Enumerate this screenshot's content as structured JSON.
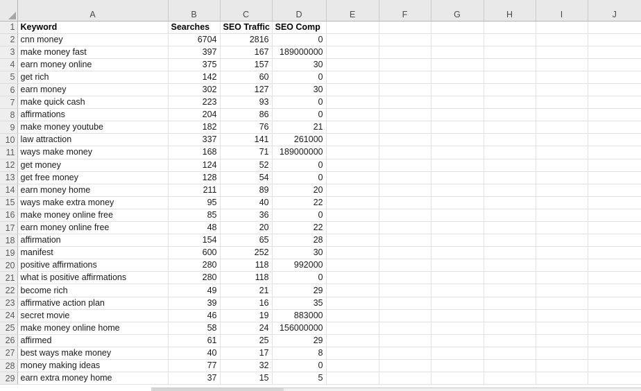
{
  "app": {
    "type": "spreadsheet",
    "corner_icon": "select-all-triangle-icon"
  },
  "columns": {
    "letters": [
      "A",
      "B",
      "C",
      "D",
      "E",
      "F",
      "G",
      "H",
      "I",
      "J"
    ]
  },
  "sheet": {
    "header_row_index": "1",
    "headers": [
      "Keyword",
      "Searches",
      "SEO Traffic",
      "SEO Comp"
    ],
    "row_numbers": [
      "1",
      "2",
      "3",
      "4",
      "5",
      "6",
      "7",
      "8",
      "9",
      "10",
      "11",
      "12",
      "13",
      "14",
      "15",
      "16",
      "17",
      "18",
      "19",
      "20",
      "21",
      "22",
      "23",
      "24",
      "25",
      "26",
      "27",
      "28",
      "29"
    ],
    "rows": [
      {
        "n": "2",
        "keyword": "cnn money",
        "searches": "6704",
        "seo_traffic": "2816",
        "seo_comp": "0"
      },
      {
        "n": "3",
        "keyword": "make money fast",
        "searches": "397",
        "seo_traffic": "167",
        "seo_comp": "189000000"
      },
      {
        "n": "4",
        "keyword": "earn money online",
        "searches": "375",
        "seo_traffic": "157",
        "seo_comp": "30"
      },
      {
        "n": "5",
        "keyword": "get rich",
        "searches": "142",
        "seo_traffic": "60",
        "seo_comp": "0"
      },
      {
        "n": "6",
        "keyword": "earn money",
        "searches": "302",
        "seo_traffic": "127",
        "seo_comp": "30"
      },
      {
        "n": "7",
        "keyword": "make quick cash",
        "searches": "223",
        "seo_traffic": "93",
        "seo_comp": "0"
      },
      {
        "n": "8",
        "keyword": "affirmations",
        "searches": "204",
        "seo_traffic": "86",
        "seo_comp": "0"
      },
      {
        "n": "9",
        "keyword": "make money youtube",
        "searches": "182",
        "seo_traffic": "76",
        "seo_comp": "21"
      },
      {
        "n": "10",
        "keyword": "law attraction",
        "searches": "337",
        "seo_traffic": "141",
        "seo_comp": "261000"
      },
      {
        "n": "11",
        "keyword": "ways make money",
        "searches": "168",
        "seo_traffic": "71",
        "seo_comp": "189000000"
      },
      {
        "n": "12",
        "keyword": "get money",
        "searches": "124",
        "seo_traffic": "52",
        "seo_comp": "0"
      },
      {
        "n": "13",
        "keyword": "get free money",
        "searches": "128",
        "seo_traffic": "54",
        "seo_comp": "0"
      },
      {
        "n": "14",
        "keyword": "earn money home",
        "searches": "211",
        "seo_traffic": "89",
        "seo_comp": "20"
      },
      {
        "n": "15",
        "keyword": "ways make extra money",
        "searches": "95",
        "seo_traffic": "40",
        "seo_comp": "22"
      },
      {
        "n": "16",
        "keyword": "make money online free",
        "searches": "85",
        "seo_traffic": "36",
        "seo_comp": "0"
      },
      {
        "n": "17",
        "keyword": "earn money online free",
        "searches": "48",
        "seo_traffic": "20",
        "seo_comp": "22"
      },
      {
        "n": "18",
        "keyword": "affirmation",
        "searches": "154",
        "seo_traffic": "65",
        "seo_comp": "28"
      },
      {
        "n": "19",
        "keyword": "manifest",
        "searches": "600",
        "seo_traffic": "252",
        "seo_comp": "30"
      },
      {
        "n": "20",
        "keyword": "positive affirmations",
        "searches": "280",
        "seo_traffic": "118",
        "seo_comp": "992000"
      },
      {
        "n": "21",
        "keyword": "what is positive affirmations",
        "searches": "280",
        "seo_traffic": "118",
        "seo_comp": "0"
      },
      {
        "n": "22",
        "keyword": "become rich",
        "searches": "49",
        "seo_traffic": "21",
        "seo_comp": "29"
      },
      {
        "n": "23",
        "keyword": "affirmative action plan",
        "searches": "39",
        "seo_traffic": "16",
        "seo_comp": "35"
      },
      {
        "n": "24",
        "keyword": "secret movie",
        "searches": "46",
        "seo_traffic": "19",
        "seo_comp": "883000"
      },
      {
        "n": "25",
        "keyword": "make money online home",
        "searches": "58",
        "seo_traffic": "24",
        "seo_comp": "156000000"
      },
      {
        "n": "26",
        "keyword": "affirmed",
        "searches": "61",
        "seo_traffic": "25",
        "seo_comp": "29"
      },
      {
        "n": "27",
        "keyword": "best ways make money",
        "searches": "40",
        "seo_traffic": "17",
        "seo_comp": "8"
      },
      {
        "n": "28",
        "keyword": "money making ideas",
        "searches": "77",
        "seo_traffic": "32",
        "seo_comp": "0"
      },
      {
        "n": "29",
        "keyword": "earn extra money home",
        "searches": "37",
        "seo_traffic": "15",
        "seo_comp": "5"
      }
    ]
  },
  "colors": {
    "header_bg": "#e9e9e9",
    "rowhead_bg": "#eeeeee",
    "gridline": "#e2e2e2",
    "header_divider": "#b4b4b4",
    "cell_bg": "#ffffff",
    "text": "#1a1a1a",
    "header_letter_text": "#4a4a4a"
  }
}
